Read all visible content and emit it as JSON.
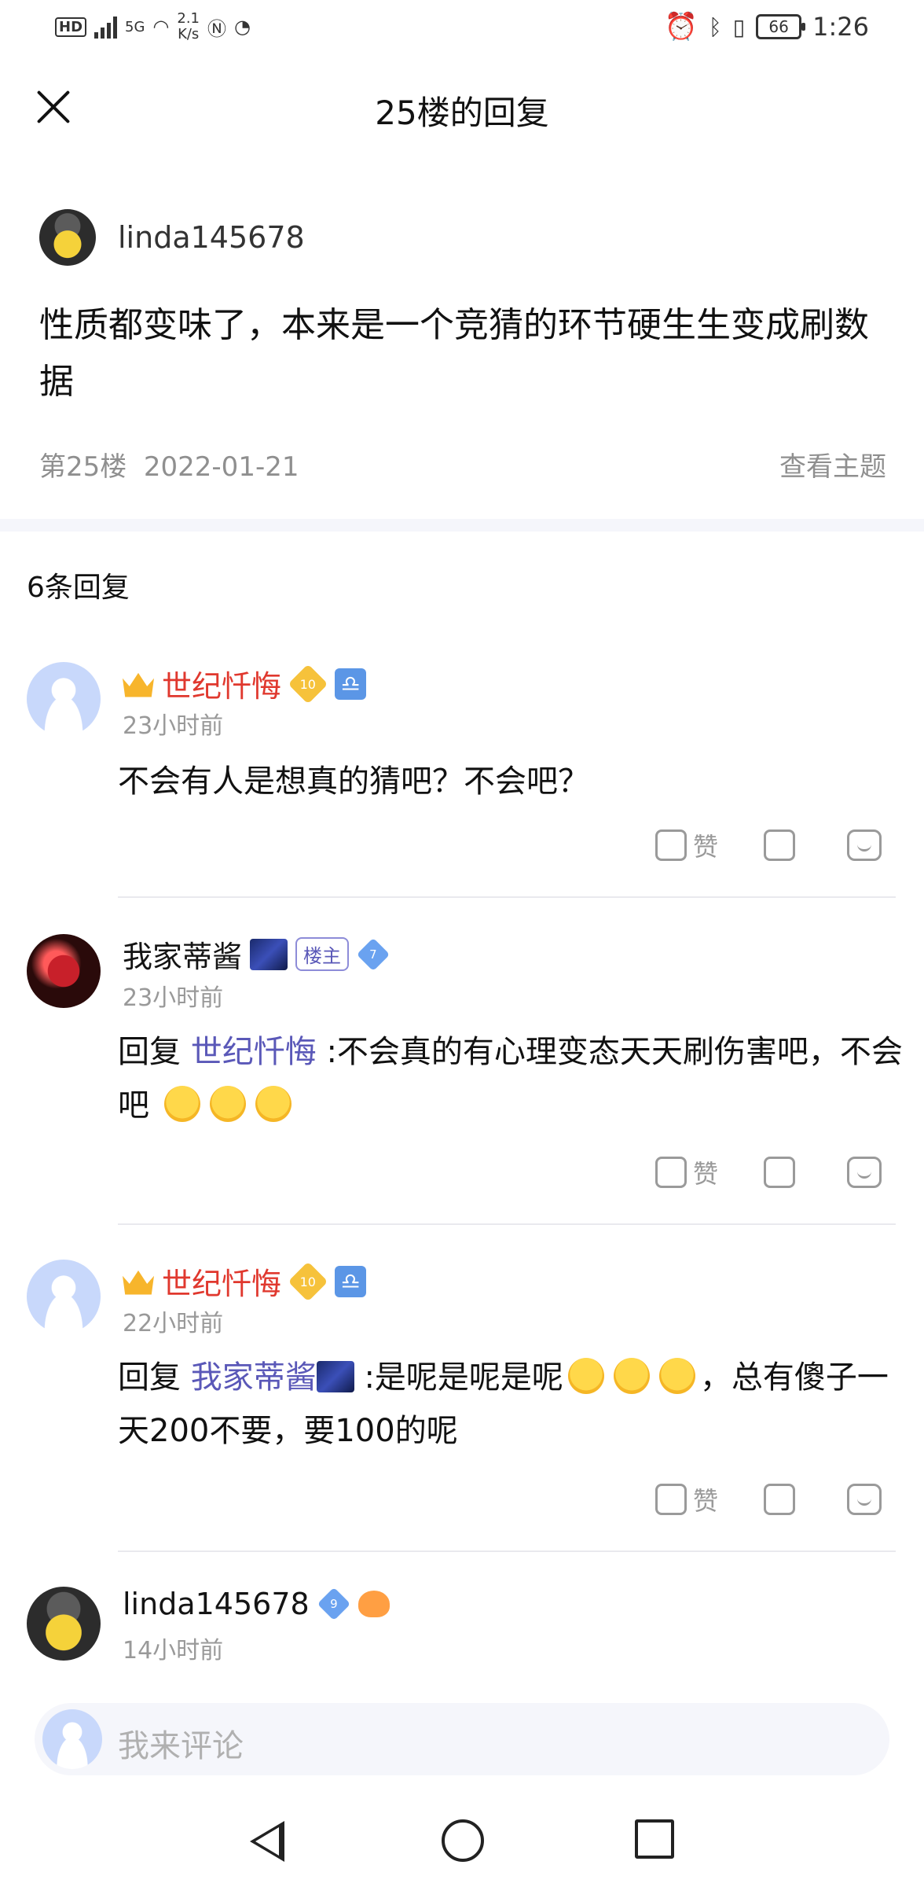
{
  "status_bar": {
    "left": {
      "hd": "HD",
      "network": "5G",
      "speed": "2.1",
      "speed_unit": "K/s"
    },
    "right": {
      "battery": "66",
      "time": "1:26"
    }
  },
  "header": {
    "title": "25楼的回复"
  },
  "post": {
    "username": "linda145678",
    "content": "性质都变味了，本来是一个竞猜的环节硬生生变成刷数据",
    "floor": "第25楼",
    "date": "2022-01-21",
    "view_topic": "查看主题"
  },
  "replies_count": "6条回复",
  "replies": [
    {
      "name": "世纪忏悔",
      "level": "10",
      "time": "23小时前",
      "text": "不会有人是想真的猜吧？不会吧？",
      "like_label": "赞"
    },
    {
      "name": "我家蒂酱",
      "host_badge": "楼主",
      "level": "7",
      "time": "23小时前",
      "reply_prefix": "回复",
      "reply_to": "世纪忏悔",
      "text": " :不会真的有心理变态天天刷伤害吧，不会吧",
      "like_label": "赞"
    },
    {
      "name": "世纪忏悔",
      "level": "10",
      "time": "22小时前",
      "reply_prefix": "回复",
      "reply_to": "我家蒂酱",
      "text_a": " :是呢是呢是呢",
      "text_b": "，总有傻子一天200不要，要100的呢",
      "like_label": "赞"
    },
    {
      "name": "linda145678",
      "level": "9",
      "time": "14小时前"
    }
  ],
  "comment_input": {
    "placeholder": "我来评论"
  },
  "icons": {
    "close": "close-icon",
    "like": "thumbs-up-icon",
    "dislike": "thumbs-down-icon",
    "comment": "comment-icon",
    "back": "back-icon",
    "home": "home-icon",
    "recent": "recent-apps-icon"
  },
  "colors": {
    "accent_red": "#e0382e",
    "link_blue": "#5a58b8"
  }
}
